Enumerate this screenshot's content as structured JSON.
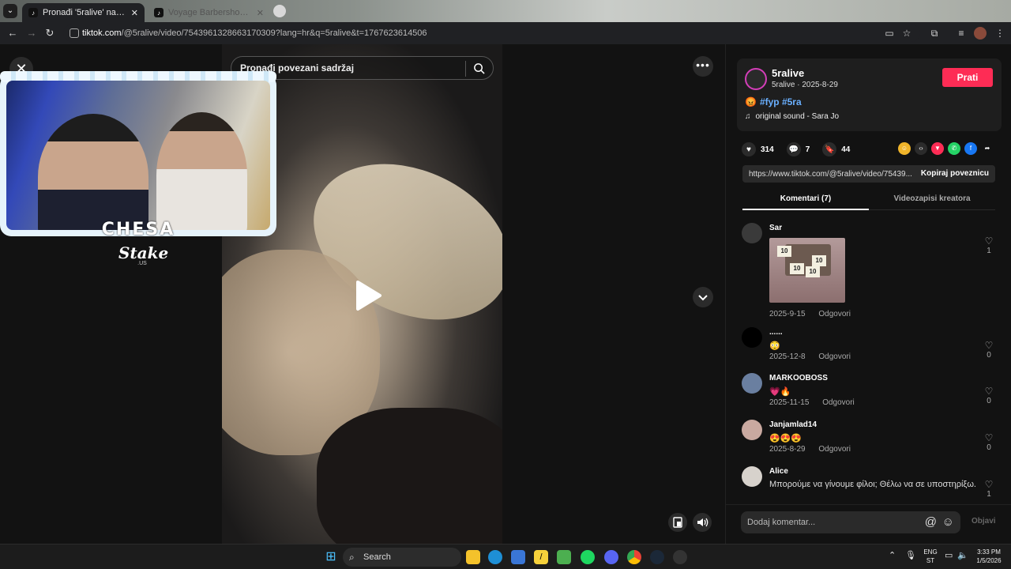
{
  "browser": {
    "tabs": [
      {
        "title": "Pronađi '5ralive' na TikToku | Pr"
      },
      {
        "title": "Voyage Barbershop Review"
      }
    ],
    "url_host": "tiktok.com",
    "url_path": "/@5ralive/video/7543961328663170309?lang=hr&q=5ralive&t=1767623614506"
  },
  "player": {
    "search_placeholder": "Pronađi povezani sadržaj",
    "overlay_text": "CHESA",
    "overlay_brand": "Stake",
    "overlay_brand_sub": ".US"
  },
  "author": {
    "name": "5ralive",
    "sub": "5ralive · 2025-8-29",
    "follow_label": "Prati",
    "caption": "#fyp #5ra",
    "caption_emoji": "😡",
    "sound": "original sound - Sara Jo"
  },
  "stats": {
    "likes": "314",
    "comments": "7",
    "saves": "44"
  },
  "link": {
    "url": "https://www.tiktok.com/@5ralive/video/75439...",
    "copy_label": "Kopiraj poveznicu"
  },
  "tabs": {
    "comments": "Komentari (7)",
    "creator_videos": "Videozapisi kreatora"
  },
  "comments": [
    {
      "user": "Sar",
      "text": "",
      "date": "2025-9-15",
      "reply": "Odgovori",
      "likes": "1",
      "sticker": [
        "10",
        "10",
        "10",
        "10"
      ]
    },
    {
      "user": "......",
      "text": "😳",
      "date": "2025-12-8",
      "reply": "Odgovori",
      "likes": "0"
    },
    {
      "user": "MARKOOBOSS",
      "text": "💗🔥",
      "date": "2025-11-15",
      "reply": "Odgovori",
      "likes": "0"
    },
    {
      "user": "Janjamlad14",
      "text": "😍😍😍",
      "date": "2025-8-29",
      "reply": "Odgovori",
      "likes": "0"
    },
    {
      "user": "Alice",
      "text": "Μπορούμε να γίνουμε φίλοι; Θέλω να σε υποστηρίξω.",
      "date": "",
      "reply": "",
      "likes": "1"
    }
  ],
  "footer": {
    "placeholder": "Dodaj komentar...",
    "post_label": "Objavi"
  },
  "taskbar": {
    "search_label": "Search",
    "lang": "ENG",
    "lang_sub": "ST",
    "time": "3:33 PM",
    "date": "1/5/2026"
  },
  "colors": {
    "accent": "#fe2c55",
    "link_blue": "#6ab0ff",
    "panel_bg": "#121212"
  }
}
